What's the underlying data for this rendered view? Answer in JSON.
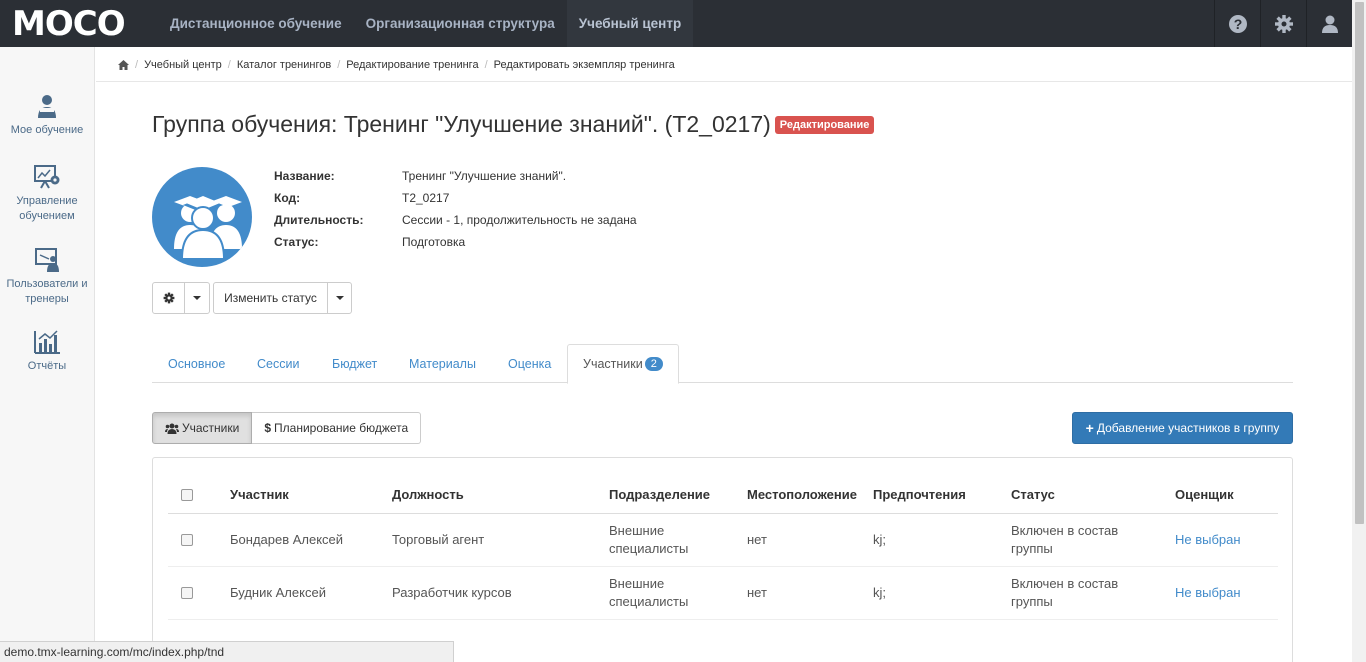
{
  "app": {
    "logo": "MOCO"
  },
  "topnav": [
    {
      "label": "Дистанционное обучение"
    },
    {
      "label": "Организационная структура"
    },
    {
      "label": "Учебный центр"
    }
  ],
  "sidebar": [
    {
      "label": "Мое обучение",
      "icon": "student-icon"
    },
    {
      "label": "Управление обучением",
      "icon": "presentation-gear-icon"
    },
    {
      "label": "Пользователи и тренеры",
      "icon": "trainer-board-icon"
    },
    {
      "label": "Отчёты",
      "icon": "bar-chart-icon"
    }
  ],
  "breadcrumb": [
    "Учебный центр",
    "Каталог тренингов",
    "Редактирование тренинга",
    "Редактировать экземпляр тренинга"
  ],
  "title": "Группа обучения: Тренинг \"Улучшение знаний\". (T2_0217)",
  "edit_badge": "Редактирование",
  "info": [
    {
      "label": "Название:",
      "value": "Тренинг \"Улучшение знаний\"."
    },
    {
      "label": "Код:",
      "value": "T2_0217"
    },
    {
      "label": "Длительность:",
      "value": "Сессии - 1, продолжительность не задана"
    },
    {
      "label": "Статус:",
      "value": "Подготовка"
    }
  ],
  "buttons": {
    "change_status": "Изменить статус",
    "add_participants": "Добавление участников в группу"
  },
  "tabs": [
    "Основное",
    "Сессии",
    "Бюджет",
    "Материалы",
    "Оценка",
    "Участники"
  ],
  "participants_count": "2",
  "view_toggle": {
    "participants": "Участники",
    "budget": "Планирование бюджета"
  },
  "table": {
    "headers": [
      "Участник",
      "Должность",
      "Подразделение",
      "Местоположение",
      "Предпочтения",
      "Статус",
      "Оценщик"
    ],
    "rows": [
      [
        "Бондарев Алексей",
        "Торговый агент",
        "Внешние специалисты",
        "нет",
        "kj;",
        "Включен в состав группы",
        "Не выбран"
      ],
      [
        "Будник Алексей",
        "Разработчик курсов",
        "Внешние специалисты",
        "нет",
        "kj;",
        "Включен в состав группы",
        "Не выбран"
      ]
    ]
  },
  "statusbar": "demo.tmx-learning.com/mc/index.php/tnd"
}
